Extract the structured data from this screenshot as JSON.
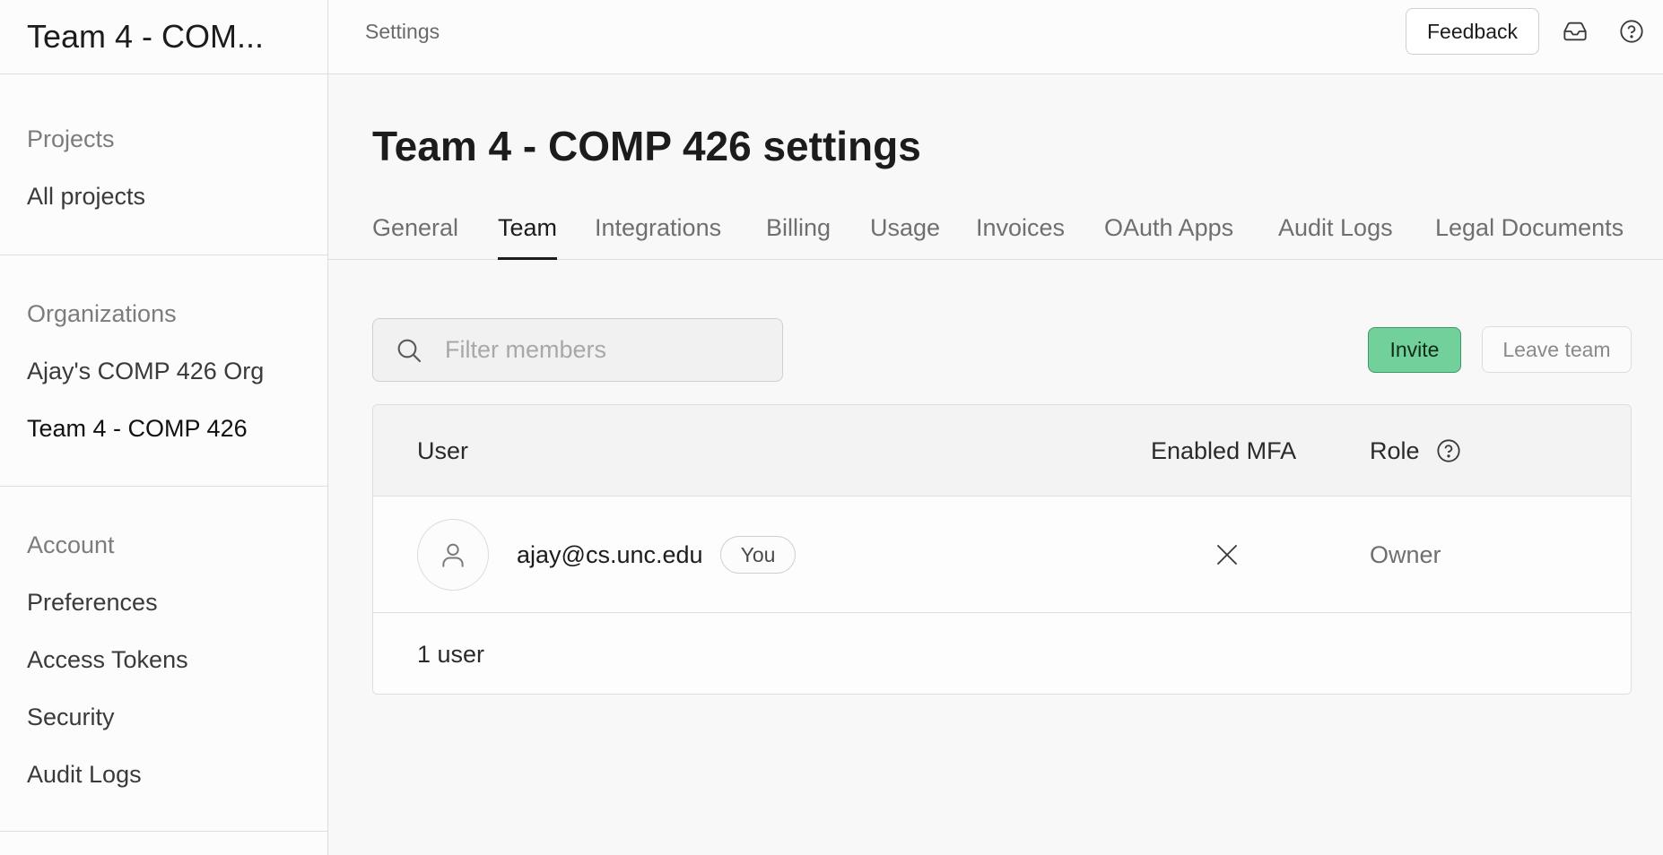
{
  "sidebar": {
    "title": "Team 4 - COM...",
    "sections": {
      "projects": {
        "heading": "Projects",
        "items": [
          "All projects"
        ]
      },
      "organizations": {
        "heading": "Organizations",
        "items": [
          "Ajay's COMP 426 Org",
          "Team 4 - COMP 426"
        ]
      },
      "account": {
        "heading": "Account",
        "items": [
          "Preferences",
          "Access Tokens",
          "Security",
          "Audit Logs"
        ]
      }
    },
    "active_item": "Team 4 - COMP 426"
  },
  "topbar": {
    "breadcrumb": "Settings",
    "feedback_label": "Feedback",
    "icons": [
      "inbox-icon",
      "help-icon"
    ]
  },
  "main": {
    "title": "Team 4 - COMP 426 settings",
    "tabs": [
      "General",
      "Team",
      "Integrations",
      "Billing",
      "Usage",
      "Invoices",
      "OAuth Apps",
      "Audit Logs",
      "Legal Documents"
    ],
    "active_tab": "Team",
    "search": {
      "placeholder": "Filter members",
      "value": ""
    },
    "invite_label": "Invite",
    "leave_label": "Leave team",
    "accent_color": "#72d19b",
    "table": {
      "headers": {
        "user": "User",
        "mfa": "Enabled MFA",
        "role": "Role"
      },
      "rows": [
        {
          "email": "ajay@cs.unc.edu",
          "badge": "You",
          "mfa_enabled": false,
          "role": "Owner"
        }
      ],
      "footer": "1 user"
    }
  }
}
